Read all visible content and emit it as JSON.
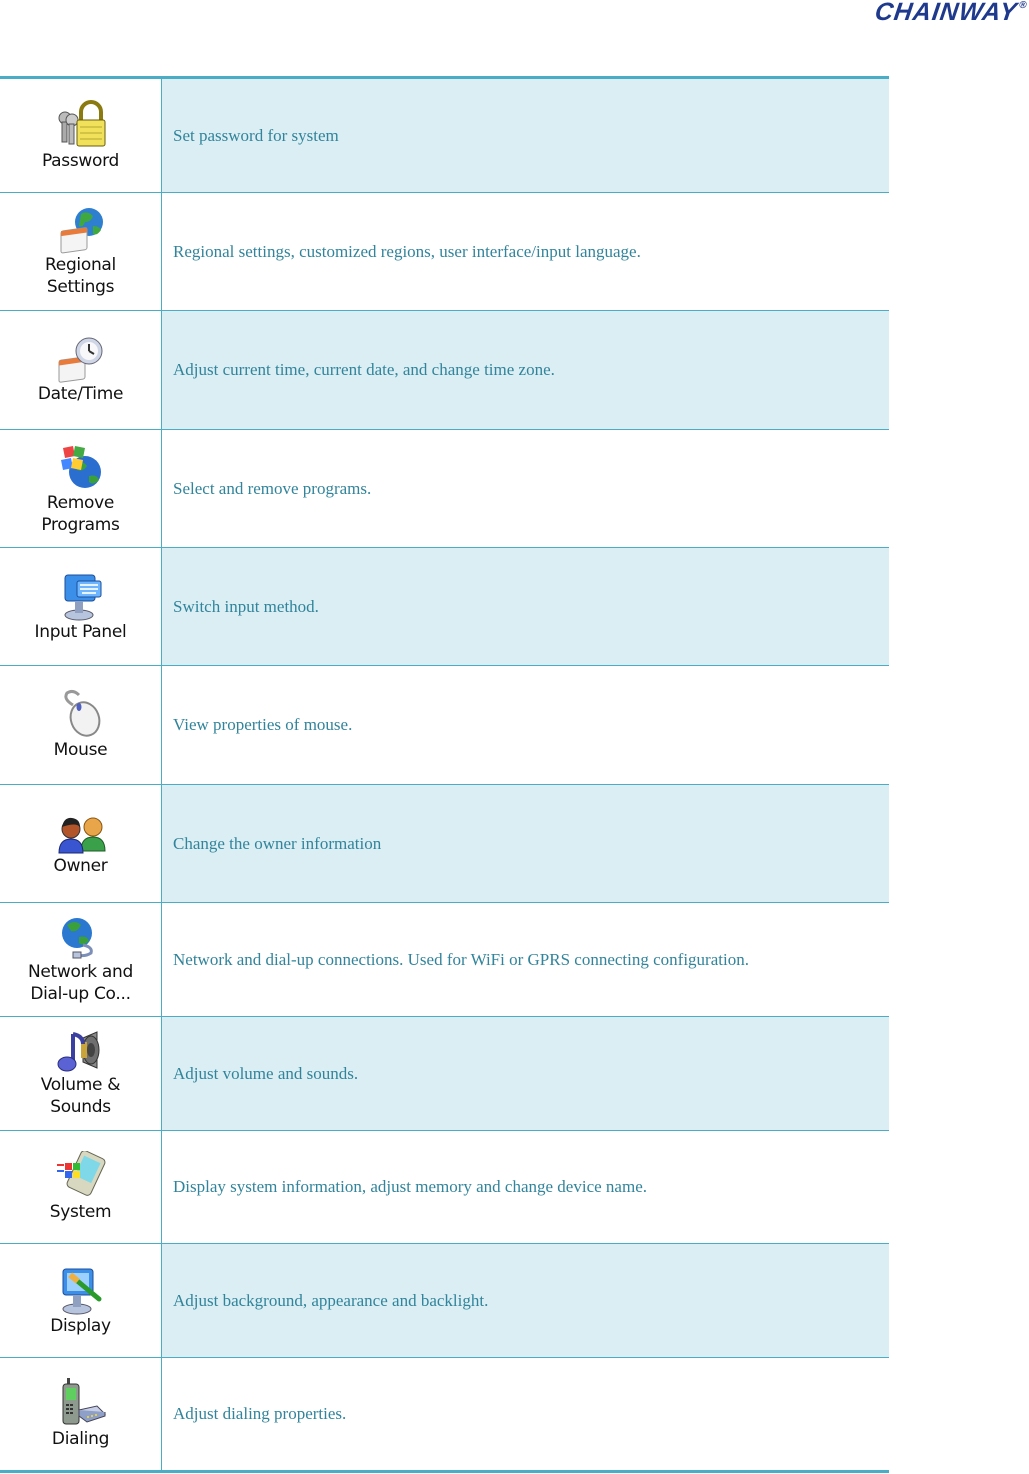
{
  "header": {
    "logo_text": "CHAINWAY",
    "logo_mark": "®",
    "brand_color": "#1f3a8c"
  },
  "theme": {
    "border_color": "#4bacc6",
    "shade_color": "#daeef3",
    "text_color": "#31849b"
  },
  "items": [
    {
      "icon": "password-icon",
      "label": "Password",
      "description": "Set password for system"
    },
    {
      "icon": "regional-settings-icon",
      "label": "Regional\nSettings",
      "description": "Regional settings, customized regions, user interface/input language."
    },
    {
      "icon": "date-time-icon",
      "label": "Date/Time",
      "description": "Adjust current time, current date, and change time zone."
    },
    {
      "icon": "remove-programs-icon",
      "label": "Remove\nPrograms",
      "description": "Select and remove programs."
    },
    {
      "icon": "input-panel-icon",
      "label": "Input Panel",
      "description": "Switch input method."
    },
    {
      "icon": "mouse-icon",
      "label": "Mouse",
      "description": "View properties of mouse."
    },
    {
      "icon": "owner-icon",
      "label": "Owner",
      "description": "Change the owner information"
    },
    {
      "icon": "network-icon",
      "label": "Network and\nDial-up Co...",
      "description": "Network and dial-up connections. Used for WiFi or GPRS connecting configuration."
    },
    {
      "icon": "volume-sounds-icon",
      "label": "Volume &\nSounds",
      "description": "Adjust volume and sounds."
    },
    {
      "icon": "system-icon",
      "label": "System",
      "description": "Display system information, adjust memory and change device name."
    },
    {
      "icon": "display-icon",
      "label": "Display",
      "description": "Adjust background, appearance and backlight."
    },
    {
      "icon": "dialing-icon",
      "label": "Dialing",
      "description": "Adjust dialing properties."
    }
  ]
}
